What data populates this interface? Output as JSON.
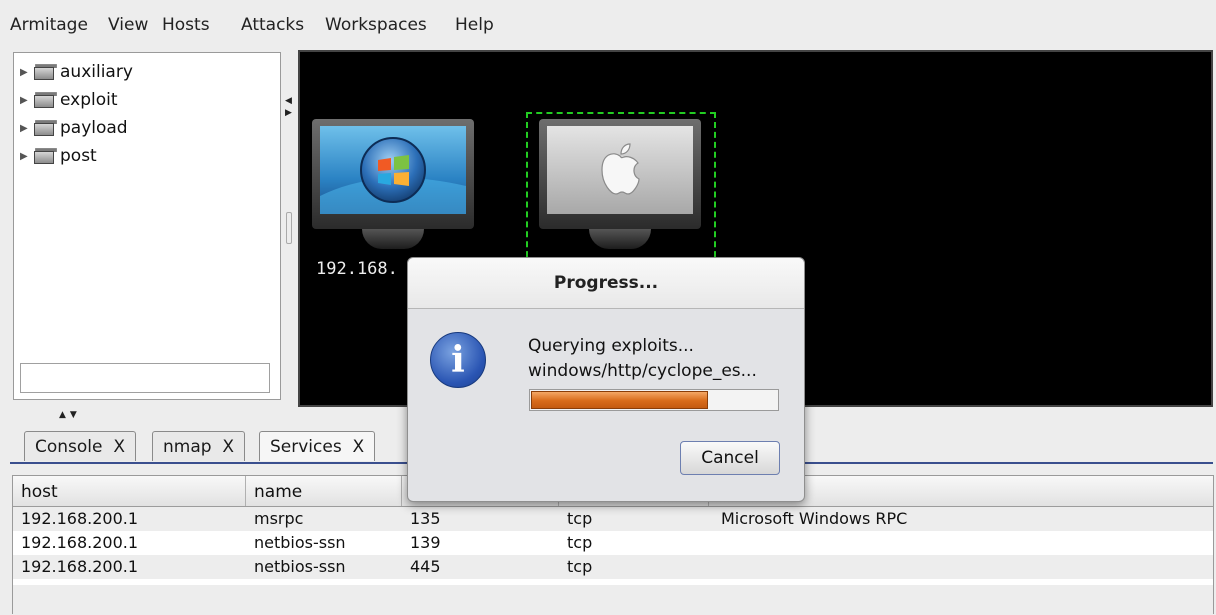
{
  "menu": [
    "Armitage",
    "View",
    "Hosts",
    "Attacks",
    "Workspaces",
    "Help"
  ],
  "module_tree": [
    "auxiliary",
    "exploit",
    "payload",
    "post"
  ],
  "module_search": "",
  "hosts": [
    {
      "ip": "192.168.",
      "os": "windows-logo-icon"
    },
    {
      "ip": "",
      "os": "apple-logo-icon",
      "selected": true
    }
  ],
  "tabs": [
    {
      "label": "Console",
      "close": "X"
    },
    {
      "label": "nmap",
      "close": "X"
    },
    {
      "label": "Services",
      "close": "X",
      "active": true
    }
  ],
  "table": {
    "columns": [
      "host",
      "name",
      "",
      "",
      ""
    ],
    "rows": [
      [
        "192.168.200.1",
        "msrpc",
        "135",
        "tcp",
        "Microsoft Windows RPC"
      ],
      [
        "192.168.200.1",
        "netbios-ssn",
        "139",
        "tcp",
        ""
      ],
      [
        "192.168.200.1",
        "netbios-ssn",
        "445",
        "tcp",
        ""
      ]
    ]
  },
  "dialog": {
    "title": "Progress...",
    "line1": "Querying exploits...",
    "line2": "windows/http/cyclope_es...",
    "progress": 0.72,
    "cancel": "Cancel",
    "icon": "info-icon"
  },
  "colors": {
    "progress": "#d86b1a",
    "selection": "#22cc22",
    "tab_underline": "#3a4f8e"
  }
}
